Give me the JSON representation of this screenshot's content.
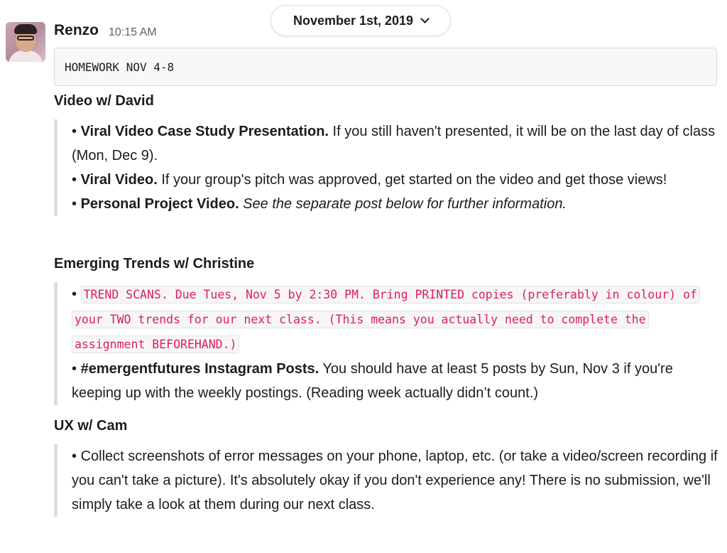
{
  "date_divider": {
    "label": "November 1st, 2019",
    "chevron_icon": "chevron-down-icon"
  },
  "message": {
    "sender": "Renzo",
    "timestamp": "10:15 AM",
    "avatar_icon": "user-avatar",
    "code_block": "HOMEWORK NOV 4-8",
    "sections": [
      {
        "title": "Video w/ David",
        "items": [
          {
            "bullet": "•",
            "bold": "Viral Video Case Study Presentation.",
            "text": " If you still haven't presented, it will be on the last day of class (Mon, Dec 9)."
          },
          {
            "bullet": "•",
            "bold": "Viral Video.",
            "text": " If your group's pitch was approved, get started on the video and get those views!"
          },
          {
            "bullet": "•",
            "bold": "Personal Project Video.",
            "italic": " See the separate post below for further information."
          }
        ]
      },
      {
        "title": "Emerging Trends w/ Christine",
        "items": [
          {
            "bullet": "•",
            "code": "TREND SCANS. Due Tues, Nov 5 by 2:30 PM. Bring PRINTED copies (preferably in colour) of your TWO trends for our next class. (This means you actually need to complete the assignment BEFOREHAND.)"
          },
          {
            "bullet": "•",
            "bold": "#emergentfutures Instagram Posts.",
            "text": " You should have at least 5 posts by Sun, Nov 3 if you're keeping up with the weekly postings. (Reading week actually didn’t count.)"
          }
        ]
      },
      {
        "title": "UX w/ Cam",
        "items": [
          {
            "bullet": "•",
            "text": " Collect screenshots of error messages on your phone, laptop, etc. (or take a video/screen recording if you can't take a picture). It's absolutely okay if you don't experience any! There is no submission, we'll simply take a look at them during our next class."
          }
        ]
      }
    ]
  },
  "colors": {
    "text": "#1d1c1d",
    "muted": "#616061",
    "inline_code": "#e01e5a",
    "quote_bar": "#dddddd",
    "code_bg": "#f8f8f8"
  }
}
